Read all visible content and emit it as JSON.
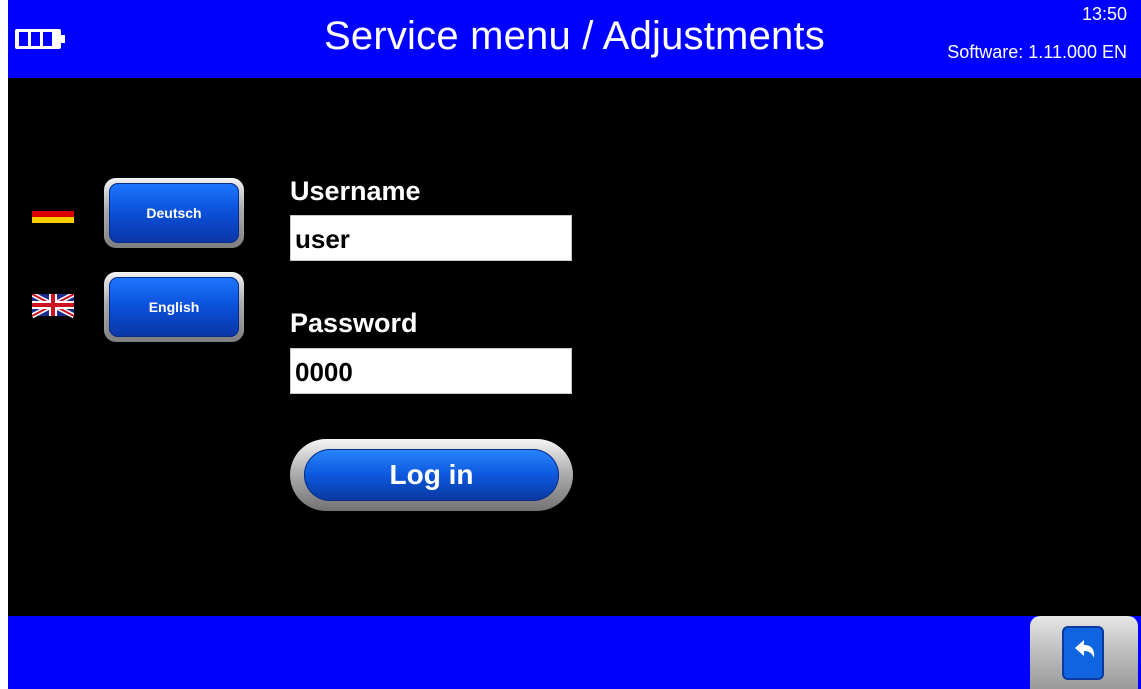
{
  "header": {
    "title": "Service menu / Adjustments",
    "time": "13:50",
    "software": "Software: 1.11.000 EN",
    "battery_icon": "battery-icon"
  },
  "languages": {
    "german": {
      "label": "Deutsch",
      "flag_icon": "germany-flag-icon"
    },
    "english": {
      "label": "English",
      "flag_icon": "uk-flag-icon"
    }
  },
  "login": {
    "username_label": "Username",
    "username_value": "user",
    "password_label": "Password",
    "password_value": "0000",
    "button_label": "Log in"
  },
  "footer": {
    "back_icon": "back-arrow-icon"
  },
  "colors": {
    "bar_blue": "#0000ff",
    "background": "#000000",
    "button_blue": "#0b4fd8"
  }
}
